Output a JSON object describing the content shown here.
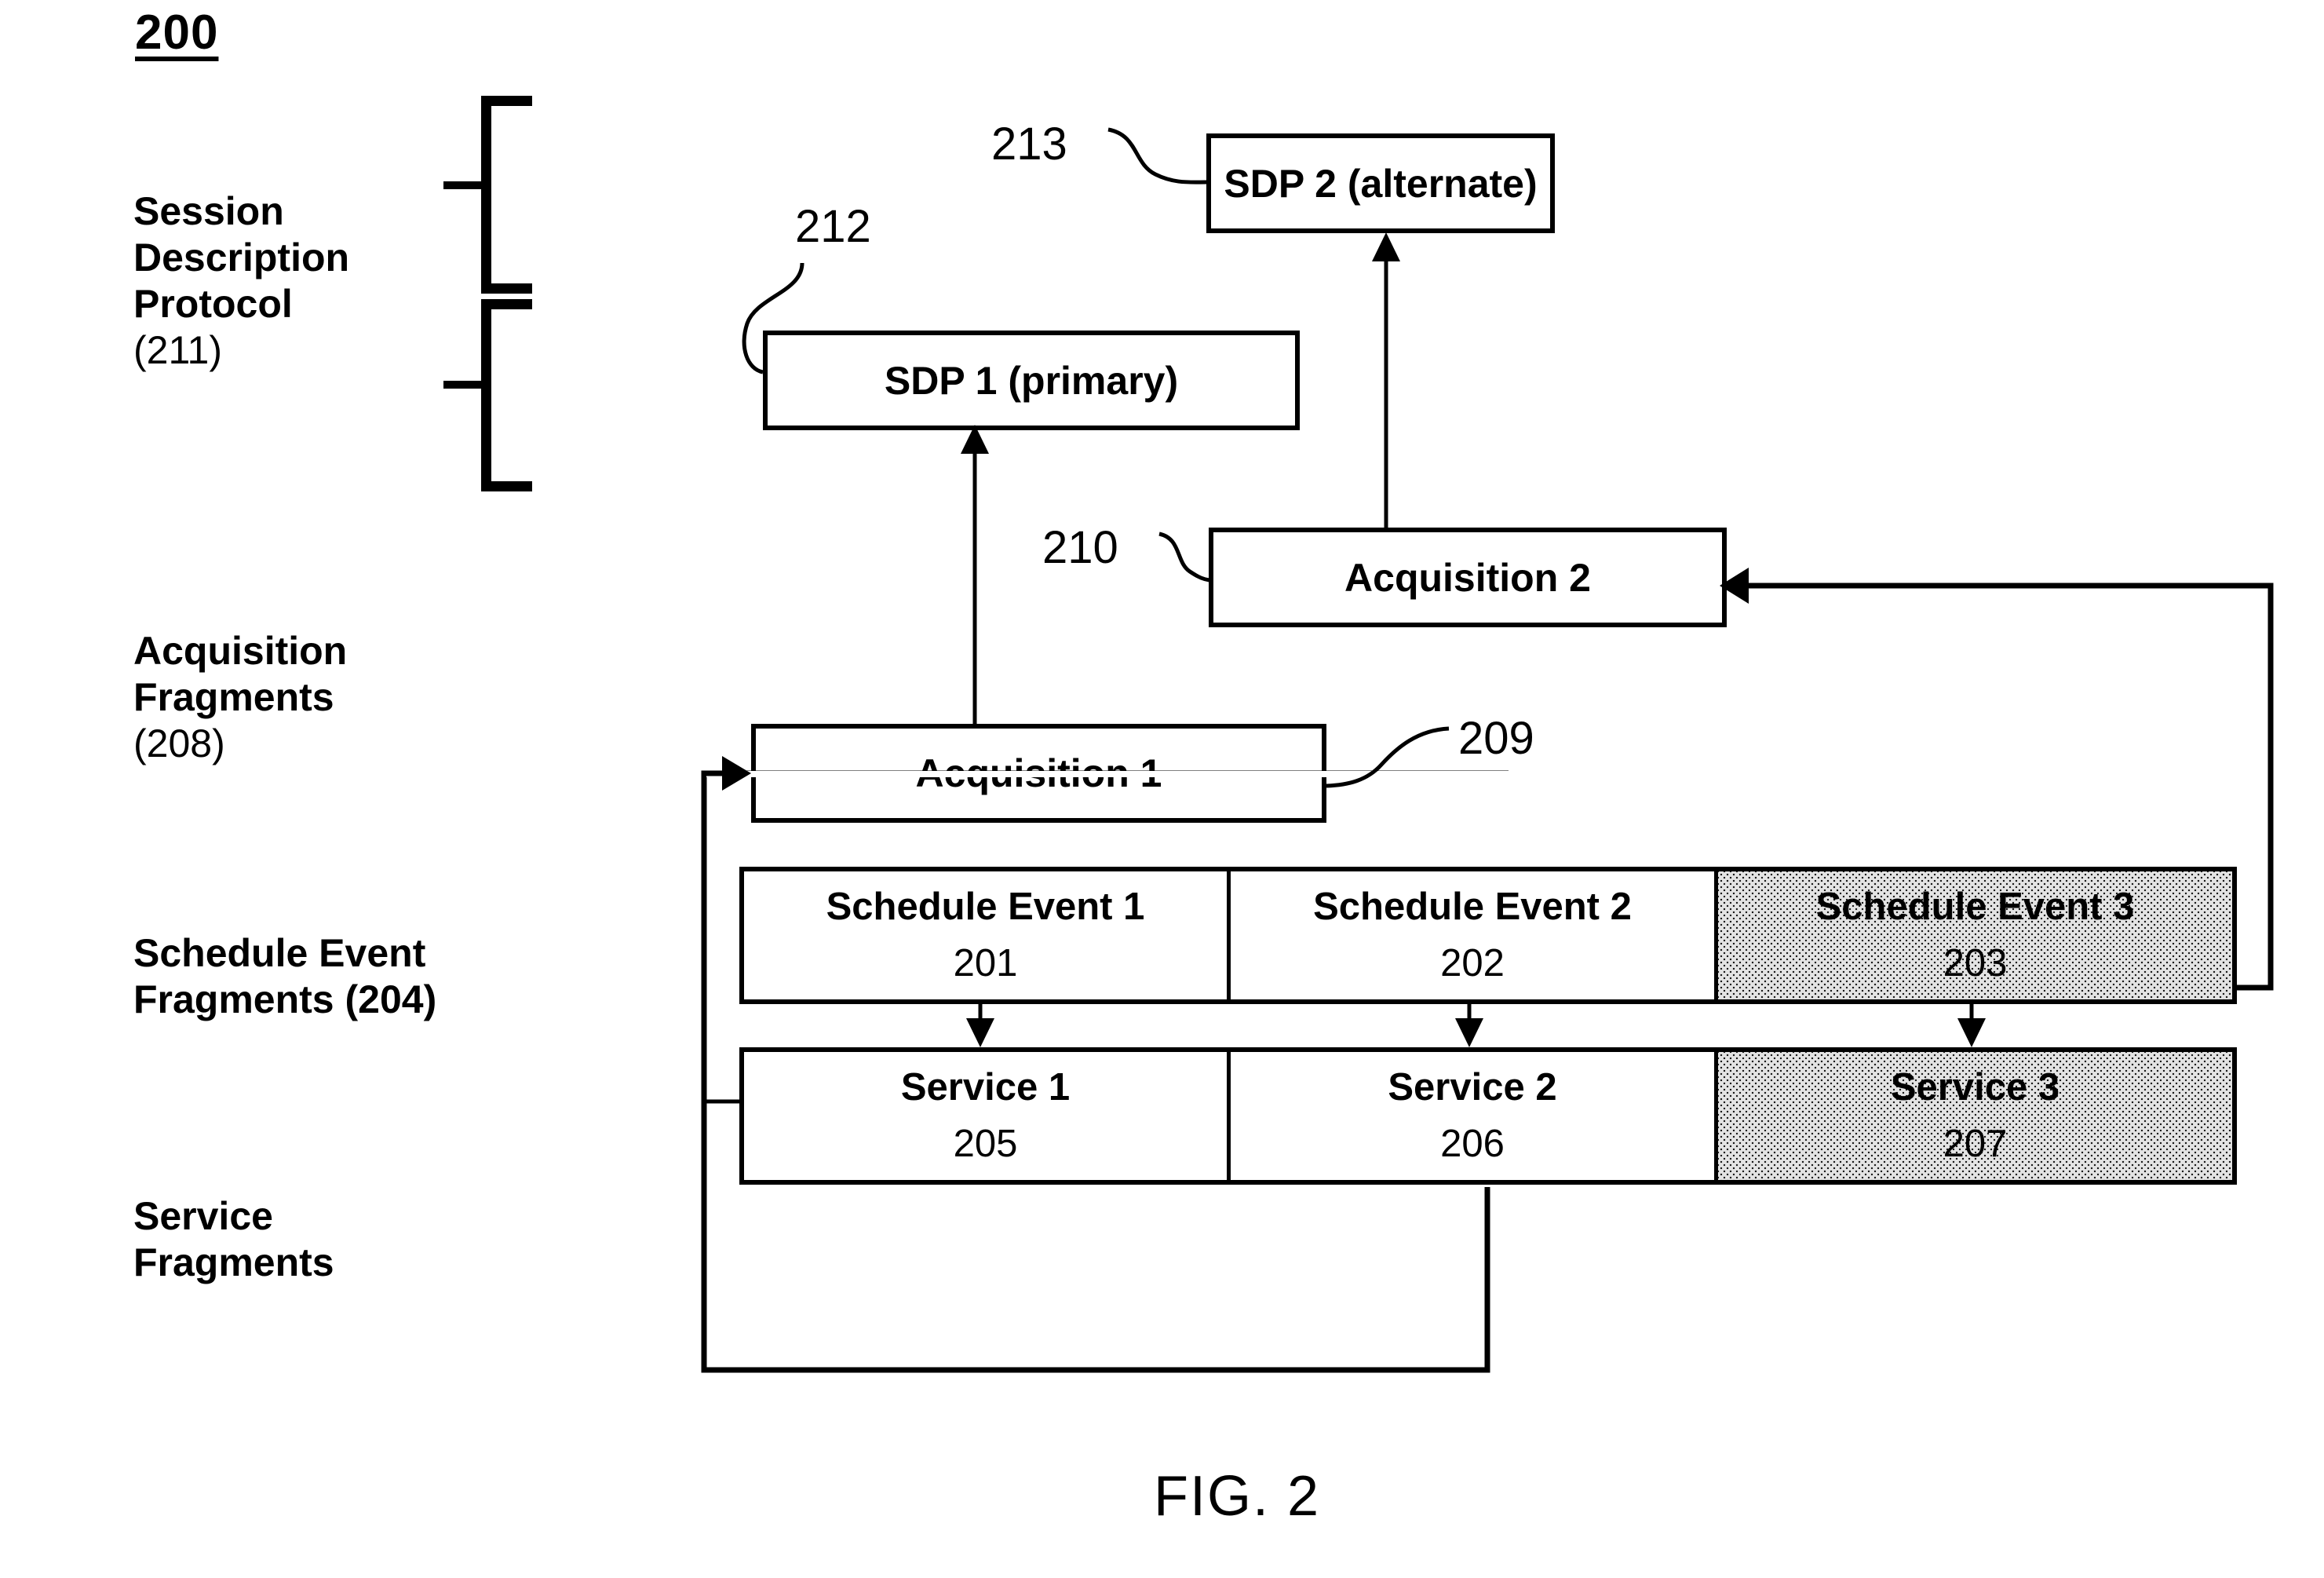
{
  "figure": {
    "number": "200",
    "caption": "FIG. 2"
  },
  "side_labels": [
    {
      "id": "sdp",
      "text": "Session\nDescription\nProtocol",
      "ref": "(211)"
    },
    {
      "id": "acq",
      "text": "Acquisition\nFragments",
      "ref": "(208)"
    },
    {
      "id": "sched",
      "text": "Schedule Event\nFragments (204)",
      "ref": ""
    },
    {
      "id": "svc",
      "text": "Service\nFragments",
      "ref": ""
    }
  ],
  "boxes": {
    "sdp1": {
      "label": "SDP 1 (primary)",
      "callout": "212"
    },
    "sdp2": {
      "label": "SDP 2 (alternate)",
      "callout": "213"
    },
    "acq1": {
      "label": "Acquisition 1",
      "callout": "209"
    },
    "acq2": {
      "label": "Acquisition 2",
      "callout": "210"
    }
  },
  "schedule_events": {
    "row_label": "Schedule Event Fragments",
    "cells": [
      {
        "title": "Schedule Event 1",
        "ref": "201",
        "hatched": false
      },
      {
        "title": "Schedule Event 2",
        "ref": "202",
        "hatched": false
      },
      {
        "title": "Schedule Event 3",
        "ref": "203",
        "hatched": true
      }
    ]
  },
  "services": {
    "row_label": "Service Fragments",
    "cells": [
      {
        "title": "Service 1",
        "ref": "205",
        "hatched": false
      },
      {
        "title": "Service 2",
        "ref": "206",
        "hatched": false
      },
      {
        "title": "Service 3",
        "ref": "207",
        "hatched": true
      }
    ]
  },
  "colors": {
    "line": "#000000",
    "background": "#ffffff",
    "hatch_fill": "#e3e3e3"
  }
}
